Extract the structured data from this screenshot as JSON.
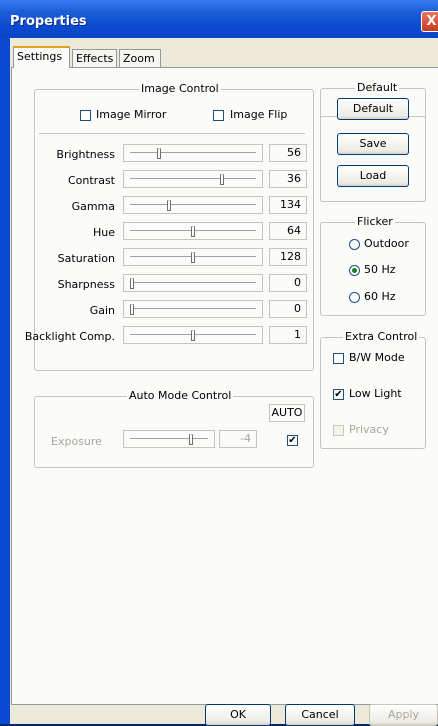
{
  "window": {
    "title": "Properties",
    "close_glyph": "X"
  },
  "tabs": [
    {
      "label": "Settings"
    },
    {
      "label": "Effects"
    },
    {
      "label": "Zoom"
    }
  ],
  "image_control": {
    "legend": "Image Control",
    "mirror_label": "Image Mirror",
    "flip_label": "Image Flip",
    "sliders": [
      {
        "label": "Brightness",
        "value": "56",
        "level": 0.22
      },
      {
        "label": "Contrast",
        "value": "36",
        "level": 0.74
      },
      {
        "label": "Gamma",
        "value": "134",
        "level": 0.3
      },
      {
        "label": "Hue",
        "value": "64",
        "level": 0.5
      },
      {
        "label": "Saturation",
        "value": "128",
        "level": 0.5
      },
      {
        "label": "Sharpness",
        "value": "0",
        "level": 0.0
      },
      {
        "label": "Gain",
        "value": "0",
        "level": 0.0
      },
      {
        "label": "Backlight Comp.",
        "value": "1",
        "level": 0.5
      }
    ]
  },
  "default_group": {
    "legend": "Default",
    "default_btn": "Default",
    "save_btn": "Save",
    "load_btn": "Load"
  },
  "flicker": {
    "legend": "Flicker",
    "options": [
      "Outdoor",
      "50 Hz",
      "60 Hz"
    ],
    "selected": "50 Hz"
  },
  "extra_control": {
    "legend": "Extra Control",
    "bw_mode": "B/W Mode",
    "low_light": "Low Light",
    "privacy": "Privacy"
  },
  "auto_mode": {
    "legend": "Auto Mode Control",
    "auto_label": "AUTO",
    "exposure_label": "Exposure",
    "exposure_value": "-4",
    "exposure_level": 0.8,
    "auto_check_glyph": "✔"
  },
  "buttons": {
    "ok": "OK",
    "cancel": "Cancel",
    "apply": "Apply"
  },
  "colors": {
    "title_bar": "#0c4bd0",
    "close_button": "#c8391f",
    "active_tab_accent": "#e3a21a"
  },
  "icons": {
    "close": "close-icon",
    "check": "check-icon"
  }
}
